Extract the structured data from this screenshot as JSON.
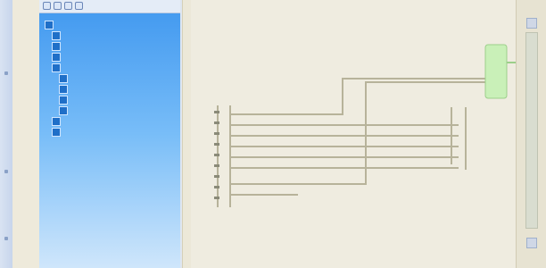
{
  "window": {
    "title": ""
  },
  "tree": {
    "nodes": [
      {
        "label": ""
      },
      {
        "label": ""
      },
      {
        "label": ""
      },
      {
        "label": ""
      },
      {
        "label": ""
      },
      {
        "label": ""
      },
      {
        "label": ""
      },
      {
        "label": ""
      },
      {
        "label": ""
      },
      {
        "label": ""
      },
      {
        "label": ""
      }
    ]
  },
  "toolbar": {
    "icons": [
      "tool-icon",
      "tool-icon",
      "tool-icon",
      "tool-icon"
    ]
  },
  "colors": {
    "tree_gradient_top": "#3f97ef",
    "tree_gradient_bottom": "#cfe6fb",
    "canvas": "#efece0",
    "wire": "#b7b39a",
    "selected_node": "#c9f0b8"
  }
}
